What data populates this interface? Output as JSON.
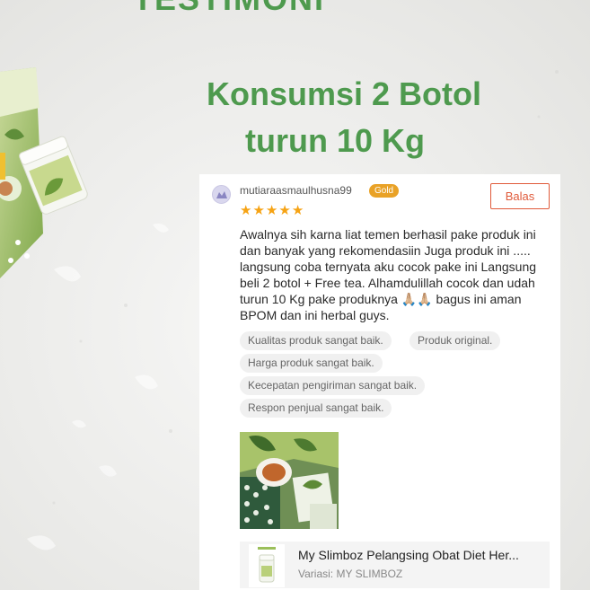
{
  "page": {
    "heading": "TESTIMONI",
    "headline_line1": "Konsumsi 2 Botol",
    "headline_line2": "turun 10 Kg"
  },
  "review": {
    "username": "mutiaraasmaulhusna99",
    "badge": "Gold",
    "reply_label": "Balas",
    "rating": 5,
    "text": "Awalnya sih karna liat temen berhasil pake produk ini dan banyak yang rekomendasiin Juga produk ini ..... langsung coba ternyata aku cocok pake ini Langsung beli 2 botol + Free tea. Alhamdulillah cocok dan udah turun 10 Kg pake produknya 🙏🏼🙏🏼 bagus ini aman BPOM dan ini herbal guys.",
    "tags": [
      "Kualitas produk sangat baik.",
      "Produk original.",
      "Harga produk sangat baik.",
      "Kecepatan pengiriman sangat baik.",
      "Respon penjual sangat baik."
    ]
  },
  "product": {
    "title": "My Slimboz Pelangsing Obat Diet Her...",
    "variant": "Variasi: MY SLIMBOZ"
  },
  "colors": {
    "headline": "#4e9a4e",
    "badge": "#e9a227",
    "reply": "#e05a3a",
    "star": "#f6a314"
  }
}
